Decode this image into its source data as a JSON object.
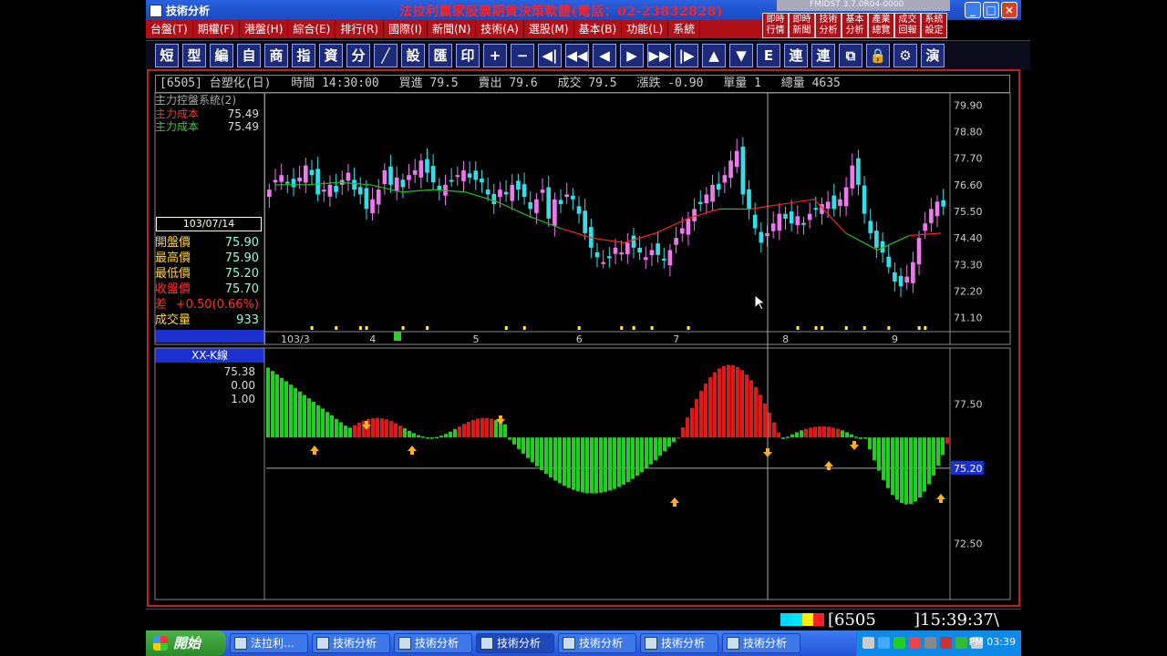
{
  "window": {
    "title": "技術分析",
    "banner": "法拉利贏家股票期貨決策軟體(電話：02-23832828)",
    "mini_title": "FMIDST 3.7.0R04-0000",
    "buttons": {
      "minimize": "_",
      "maximize": "□",
      "close": "×"
    }
  },
  "menu": [
    "台盤(T)",
    "期權(F)",
    "港盤(H)",
    "綜合(E)",
    "排行(R)",
    "國際(I)",
    "新聞(N)",
    "技術(A)",
    "選股(M)",
    "基本(B)",
    "功能(L)",
    "系統"
  ],
  "quick_buttons": [
    {
      "line1": "即時",
      "line2": "行情"
    },
    {
      "line1": "即時",
      "line2": "新聞"
    },
    {
      "line1": "技術",
      "line2": "分析"
    },
    {
      "line1": "基本",
      "line2": "分析"
    },
    {
      "line1": "產業",
      "line2": "總覽"
    },
    {
      "line1": "成交",
      "line2": "回報"
    },
    {
      "line1": "系統",
      "line2": "設定"
    }
  ],
  "toolbar": [
    {
      "label": "短",
      "icon": "short-icon"
    },
    {
      "label": "型",
      "icon": "pattern-icon"
    },
    {
      "label": "編",
      "icon": "edit-icon"
    },
    {
      "label": "自",
      "icon": "custom-icon"
    },
    {
      "label": "商",
      "icon": "product-icon"
    },
    {
      "label": "指",
      "icon": "index-icon"
    },
    {
      "label": "資",
      "icon": "data-icon"
    },
    {
      "label": "分",
      "icon": "split-icon"
    },
    {
      "label": "╱",
      "icon": "draw-line-icon"
    },
    {
      "label": "設",
      "icon": "settings-icon"
    },
    {
      "label": "匯",
      "icon": "export-icon"
    },
    {
      "label": "印",
      "icon": "print-icon"
    },
    {
      "label": "+",
      "icon": "zoom-in-icon"
    },
    {
      "label": "−",
      "icon": "zoom-out-icon"
    },
    {
      "label": "◀|",
      "icon": "first-icon"
    },
    {
      "label": "◀◀",
      "icon": "fast-back-icon"
    },
    {
      "label": "◀",
      "icon": "back-icon"
    },
    {
      "label": "▶",
      "icon": "forward-icon"
    },
    {
      "label": "▶▶",
      "icon": "fast-forward-icon"
    },
    {
      "label": "|▶",
      "icon": "last-icon"
    },
    {
      "label": "▲",
      "icon": "up-icon"
    },
    {
      "label": "▼",
      "icon": "down-icon"
    },
    {
      "label": "E",
      "icon": "esc-icon"
    },
    {
      "label": "連",
      "icon": "link-icon"
    },
    {
      "label": "連",
      "icon": "link2-icon"
    },
    {
      "label": "⧉",
      "icon": "window-icon"
    },
    {
      "label": "🔒",
      "icon": "lock-icon"
    },
    {
      "label": "⚙",
      "icon": "tool-icon"
    },
    {
      "label": "演",
      "icon": "demo-icon"
    }
  ],
  "info_bar": {
    "code": "[6505] 台塑化(日)",
    "time": "時間 14:30:00",
    "bid": "買進 79.5",
    "ask": "賣出 79.6",
    "last": "成交 79.5",
    "change": "漲跌 -0.90",
    "volume": "單量 1",
    "total": "總量 4635"
  },
  "upper_panel": {
    "title": "主力控盤系統(2)",
    "cost_red": {
      "label": "主力成本",
      "value": "75.49"
    },
    "cost_green": {
      "label": "主力成本",
      "value": "75.49"
    },
    "date": "103/07/14",
    "ohlc": [
      {
        "label": "開盤價",
        "value": "75.90",
        "color": "#ffd23c"
      },
      {
        "label": "最高價",
        "value": "75.90",
        "color": "#ffd23c"
      },
      {
        "label": "最低價",
        "value": "75.20",
        "color": "#ffd23c"
      },
      {
        "label": "收盤價",
        "value": "75.70",
        "color": "#ff3030"
      },
      {
        "label": "差",
        "value": "+0.50(0.66%)",
        "color": "#ff3030"
      },
      {
        "label": "成交量",
        "value": "933",
        "color": "#ffd23c"
      }
    ]
  },
  "lower_panel": {
    "title": "XX-K線",
    "values": [
      "75.38",
      "0.00",
      "1.00"
    ]
  },
  "status": {
    "code": "[6505",
    "time": "]15:39:37\\"
  },
  "taskbar": {
    "start": "開始",
    "tasks": [
      "法拉利...",
      "技術分析",
      "技術分析",
      "技術分析",
      "技術分析",
      "技術分析",
      "技術分析"
    ],
    "clock": "PM 03:39"
  },
  "chart_data": [
    {
      "type": "candlestick",
      "title": "[6505] 台塑化(日)",
      "x_ticks": [
        "103/3",
        "4",
        "5",
        "6",
        "7",
        "8",
        "9"
      ],
      "y_ticks": [
        79.9,
        78.8,
        77.7,
        76.6,
        75.5,
        74.4,
        73.3,
        72.2,
        71.1
      ],
      "ylim": [
        70.6,
        80.4
      ],
      "series_closes": [
        76.4,
        76.8,
        77.0,
        76.7,
        76.5,
        76.9,
        77.4,
        77.0,
        76.2,
        76.4,
        76.6,
        76.3,
        76.8,
        77.1,
        76.4,
        76.2,
        75.6,
        76.0,
        76.4,
        77.2,
        76.6,
        76.9,
        76.5,
        77.0,
        77.2,
        77.6,
        77.1,
        76.7,
        76.4,
        76.6,
        76.8,
        77.0,
        77.2,
        76.9,
        76.8,
        76.7,
        76.2,
        75.8,
        76.4,
        76.2,
        76.6,
        76.4,
        76.1,
        75.6,
        76.0,
        76.4,
        75.2,
        76.0,
        75.8,
        76.2,
        76.0,
        75.4,
        74.6,
        74.0,
        73.6,
        73.4,
        73.6,
        74.0,
        73.8,
        74.2,
        74.0,
        73.8,
        73.6,
        73.9,
        73.7,
        73.5,
        73.9,
        74.4,
        74.8,
        75.2,
        75.6,
        75.8,
        76.2,
        76.6,
        76.4,
        77.0,
        77.6,
        78.0,
        76.2,
        75.6,
        74.8,
        74.2,
        74.6,
        75.0,
        75.4,
        75.2,
        75.0,
        75.3,
        75.0,
        75.4,
        75.6,
        75.8,
        75.9,
        75.6,
        76.0,
        76.5,
        77.4,
        76.6,
        75.4,
        74.6,
        74.0,
        73.8,
        73.2,
        72.6,
        72.4,
        72.8,
        73.4,
        74.4,
        75.0,
        75.6,
        75.9,
        75.7
      ],
      "ma": [
        76.6,
        76.6,
        76.7,
        76.6,
        76.3,
        76.4,
        76.3,
        75.9,
        75.3,
        74.8,
        74.4,
        74.2,
        74.6,
        75.2,
        75.6,
        75.6,
        75.8,
        76.0,
        74.6,
        73.9,
        74.5,
        74.6
      ]
    },
    {
      "type": "bar",
      "title": "XX-K線",
      "y_ticks": [
        77.5,
        72.5
      ],
      "reference_line": 75.2,
      "ylim": [
        70.5,
        79.5
      ]
    }
  ]
}
